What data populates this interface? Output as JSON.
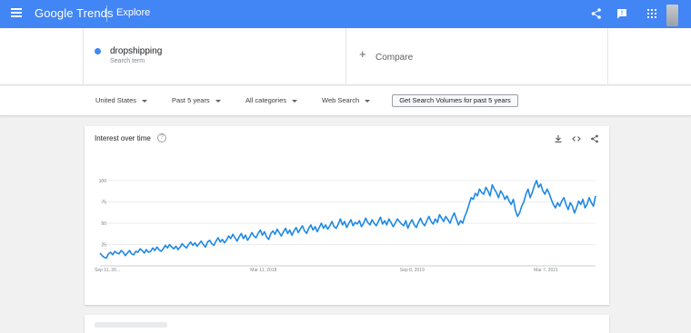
{
  "header": {
    "logo_google": "Google",
    "logo_trends": "Trends",
    "explore_label": "Explore",
    "icons": [
      "menu-icon",
      "share-icon",
      "feedback-icon",
      "apps-icon"
    ]
  },
  "search_term": {
    "name": "dropshipping",
    "type": "Search term",
    "color": "#4285f4"
  },
  "compare": {
    "plus": "+",
    "label": "Compare"
  },
  "filters": {
    "region": "United States",
    "time": "Past 5 years",
    "category": "All categories",
    "property": "Web Search",
    "volume_button": "Get Search Volumes for past 5 years"
  },
  "interest_card": {
    "title": "Interest over time",
    "help": "?",
    "icons": [
      "download-icon",
      "embed-icon",
      "share-icon"
    ]
  },
  "chart_data": {
    "type": "line",
    "y_ticks": [
      "25",
      "50",
      "75",
      "100"
    ],
    "ylim": [
      0,
      100
    ],
    "x_tick_labels": [
      "Sep 11, 20...",
      "Mar 11, 2018",
      "Sep 8, 2019",
      "Mar 7, 2021"
    ],
    "grid": true,
    "series": [
      {
        "color": "#1e88e5",
        "values": [
          15,
          12,
          10,
          9,
          14,
          16,
          13,
          17,
          15,
          14,
          18,
          16,
          12,
          15,
          18,
          14,
          13,
          17,
          16,
          20,
          18,
          15,
          19,
          16,
          17,
          21,
          18,
          22,
          19,
          17,
          20,
          24,
          21,
          25,
          22,
          20,
          23,
          19,
          22,
          26,
          23,
          21,
          25,
          28,
          24,
          27,
          23,
          26,
          29,
          25,
          22,
          28,
          30,
          26,
          24,
          29,
          33,
          28,
          31,
          27,
          30,
          35,
          32,
          37,
          33,
          29,
          34,
          38,
          32,
          36,
          30,
          34,
          39,
          35,
          33,
          38,
          42,
          36,
          40,
          34,
          31,
          38,
          41,
          37,
          43,
          39,
          35,
          40,
          44,
          38,
          42,
          36,
          41,
          45,
          39,
          43,
          47,
          41,
          38,
          44,
          48,
          42,
          46,
          40,
          45,
          50,
          44,
          48,
          43,
          47,
          52,
          46,
          44,
          49,
          55,
          48,
          52,
          45,
          50,
          54,
          47,
          51,
          49,
          53,
          46,
          50,
          56,
          51,
          48,
          54,
          50,
          47,
          52,
          57,
          49,
          53,
          48,
          55,
          51,
          46,
          50,
          55,
          52,
          49,
          47,
          53,
          44,
          50,
          54,
          48,
          45,
          51,
          56,
          50,
          47,
          53,
          58,
          52,
          49,
          55,
          51,
          60,
          56,
          52,
          58,
          54,
          50,
          57,
          62,
          55,
          48,
          53,
          50,
          58,
          64,
          72,
          80,
          78,
          85,
          82,
          90,
          86,
          84,
          92,
          88,
          82,
          95,
          90,
          86,
          80,
          88,
          84,
          78,
          82,
          76,
          72,
          78,
          65,
          58,
          62,
          70,
          75,
          84,
          90,
          80,
          86,
          94,
          100,
          92,
          96,
          88,
          84,
          90,
          85,
          78,
          72,
          68,
          74,
          70,
          76,
          80,
          72,
          66,
          74,
          70,
          62,
          68,
          76,
          72,
          78,
          68,
          72,
          80,
          74,
          70,
          82
        ]
      }
    ]
  },
  "next_card": {
    "placeholder": ""
  }
}
